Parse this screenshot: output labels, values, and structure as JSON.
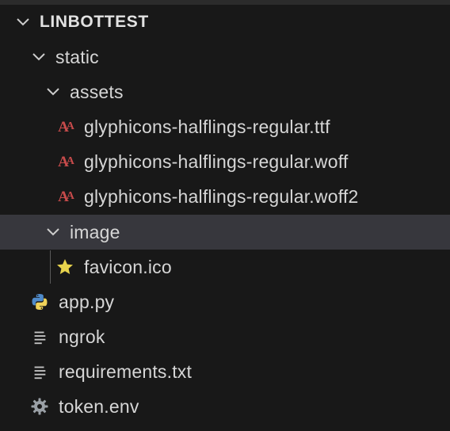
{
  "explorer": {
    "section_title": "LINBOTTEST",
    "tree": [
      {
        "label": "static",
        "kind": "folder",
        "expanded": true
      },
      {
        "label": "assets",
        "kind": "folder",
        "expanded": true
      },
      {
        "label": "glyphicons-halflings-regular.ttf",
        "kind": "font-file",
        "icon": "font-icon"
      },
      {
        "label": "glyphicons-halflings-regular.woff",
        "kind": "font-file",
        "icon": "font-icon"
      },
      {
        "label": "glyphicons-halflings-regular.woff2",
        "kind": "font-file",
        "icon": "font-icon"
      },
      {
        "label": "image",
        "kind": "folder",
        "expanded": true,
        "selected": true
      },
      {
        "label": "favicon.ico",
        "kind": "file",
        "icon": "star-icon"
      },
      {
        "label": "app.py",
        "kind": "file",
        "icon": "python-icon"
      },
      {
        "label": "ngrok",
        "kind": "file",
        "icon": "text-lines-icon"
      },
      {
        "label": "requirements.txt",
        "kind": "file",
        "icon": "text-lines-icon"
      },
      {
        "label": "token.env",
        "kind": "file",
        "icon": "gear-icon"
      }
    ]
  },
  "colors": {
    "background": "#181818",
    "selected_row": "#37373d",
    "text": "#d6d6d6",
    "font_icon": "#c74b4b",
    "star_icon": "#e8d44d",
    "python_blue": "#4f8ac9",
    "python_yellow": "#f0d35a"
  }
}
